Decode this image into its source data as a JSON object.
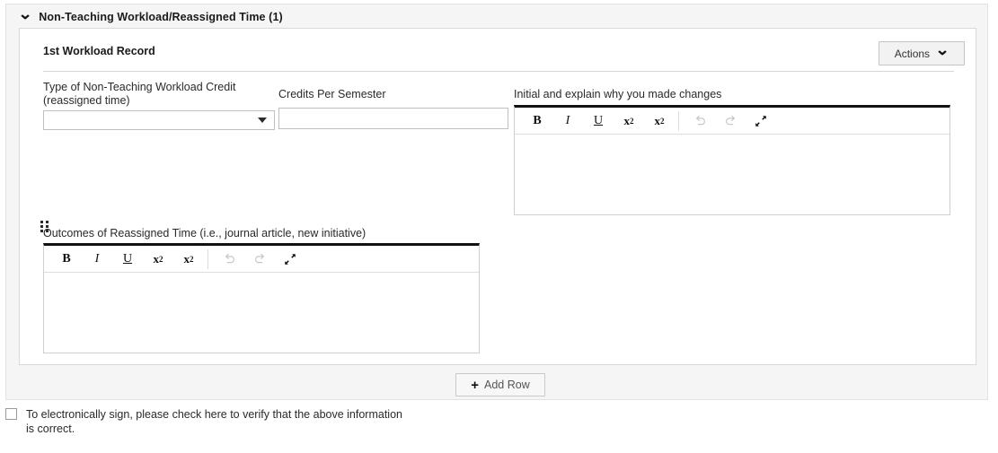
{
  "section": {
    "title": "Non-Teaching Workload/Reassigned Time (1)",
    "collapse_icon": "chevron-down-icon",
    "expanded": true
  },
  "record": {
    "title": "1st Workload Record",
    "actions": {
      "label": "Actions",
      "icon": "chevron-down-icon"
    },
    "drag_handle_icon": "drag-handle-icon",
    "fields": {
      "type_credit": {
        "label": "Type of Non-Teaching Workload Credit (reassigned time)",
        "label_line1": "Type of Non-Teaching Workload Credit",
        "label_line2": "(reassigned time)",
        "value": "",
        "placeholder": "",
        "control": "select",
        "caret_icon": "caret-down-icon"
      },
      "credits_per_semester": {
        "label": "Credits Per Semester",
        "value": "",
        "placeholder": "",
        "control": "text"
      },
      "initial_explain": {
        "label": "Initial and explain why you made changes",
        "value": "",
        "control": "rich-text"
      },
      "outcomes": {
        "label": "Outcomes of Reassigned Time (i.e., journal article, new initiative)",
        "value": "",
        "control": "rich-text"
      }
    }
  },
  "editor_toolbar": {
    "buttons": [
      {
        "name": "bold",
        "label": "B"
      },
      {
        "name": "italic",
        "label": "I"
      },
      {
        "name": "underline",
        "label": "U"
      },
      {
        "name": "superscript",
        "label": "x2"
      },
      {
        "name": "subscript",
        "label": "x2"
      },
      {
        "name": "undo",
        "label": "",
        "disabled": true
      },
      {
        "name": "redo",
        "label": "",
        "disabled": true
      },
      {
        "name": "expand",
        "label": "",
        "disabled": false
      }
    ],
    "base_char": "x",
    "sup_char": "2",
    "sub_char": "2"
  },
  "footer": {
    "add_row_label": "Add Row",
    "add_row_icon": "plus-icon"
  },
  "signature": {
    "checked": false,
    "text": "To electronically sign, please check here to verify that the above information is correct."
  },
  "colors": {
    "panel_bg": "#f5f5f5",
    "card_bg": "#ffffff",
    "border": "#d9d9d9",
    "editor_top_border": "#111111",
    "text": "#222222"
  }
}
